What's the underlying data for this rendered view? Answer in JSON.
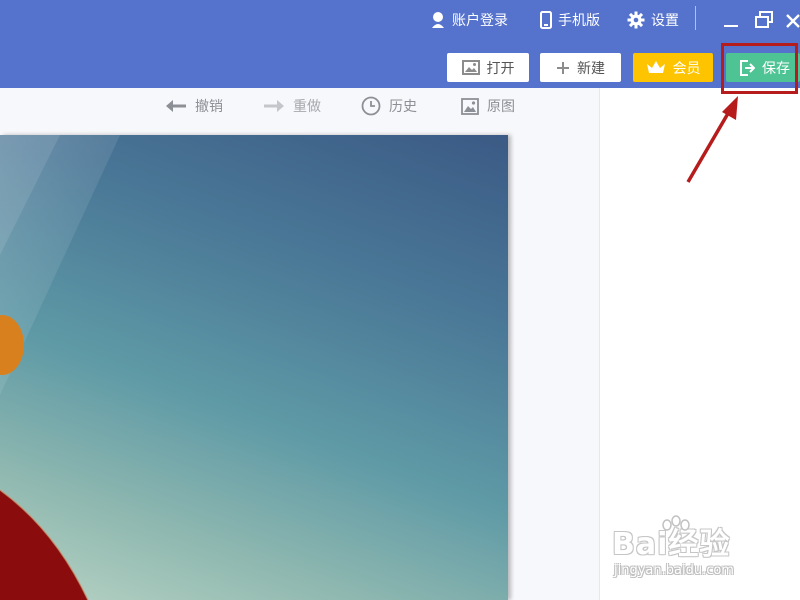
{
  "titlebar": {
    "account_label": "账户登录",
    "mobile_label": "手机版",
    "settings_label": "设置"
  },
  "actions": {
    "open_label": "打开",
    "new_label": "新建",
    "vip_label": "会员",
    "save_label": "保存"
  },
  "edit_toolbar": {
    "undo_label": "撤销",
    "redo_label": "重做",
    "history_label": "历史",
    "original_label": "原图"
  },
  "watermark": {
    "brand": "Bai经验",
    "url": "jingyan.baidu.com"
  },
  "colors": {
    "titlebar": "#5572cd",
    "vip": "#ffc400",
    "save": "#4ec394",
    "highlight": "#b71c1c"
  }
}
